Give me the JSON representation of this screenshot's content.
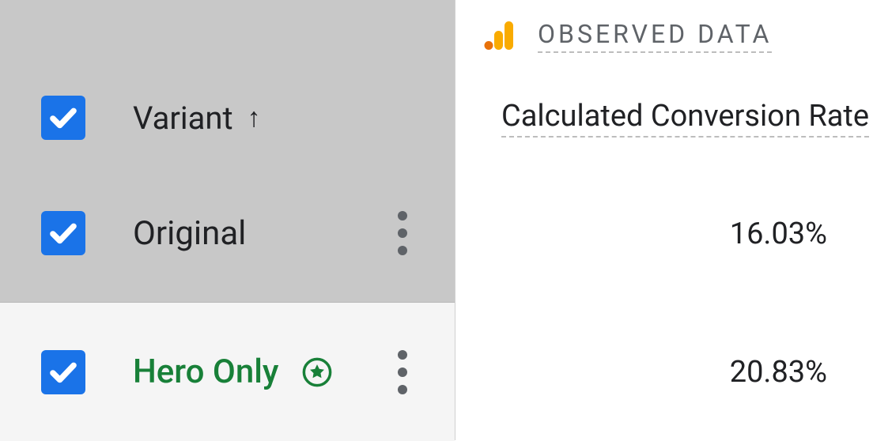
{
  "left": {
    "header": {
      "label": "Variant"
    },
    "rows": [
      {
        "name": "Original",
        "winner": false
      },
      {
        "name": "Hero Only",
        "winner": true
      }
    ]
  },
  "right": {
    "section_label": "OBSERVED DATA",
    "column_label": "Calculated Conversion Rate",
    "values": [
      "16.03%",
      "20.83%"
    ]
  }
}
